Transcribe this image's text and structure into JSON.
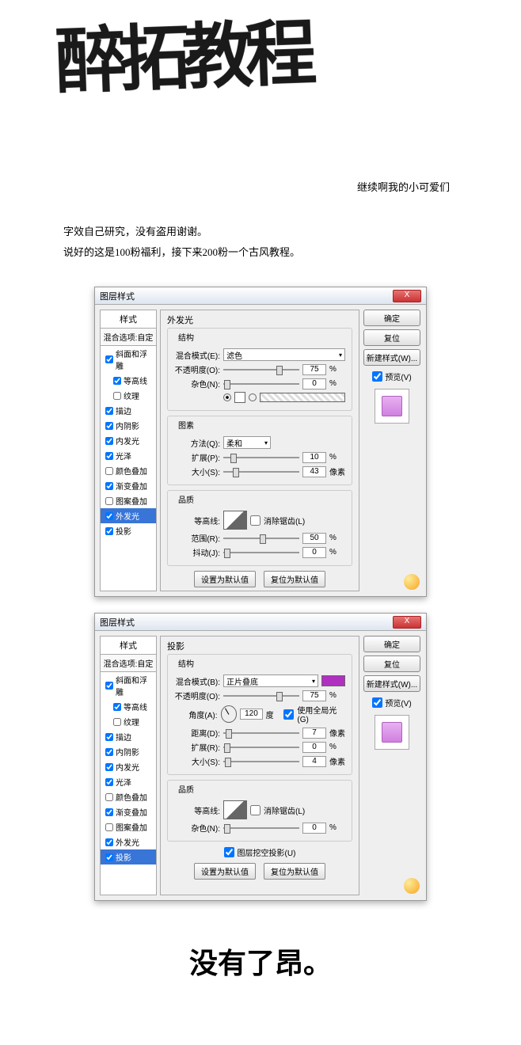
{
  "header": {
    "brush_title": "醉拓教程",
    "sub_caption": "继续啊我的小可爱们"
  },
  "intro": {
    "line1": "字效自己研究，没有盗用谢谢。",
    "line2": "说好的这是100粉福利，接下来200粉一个古风教程。"
  },
  "common": {
    "dialog_title": "图层样式",
    "close": "X",
    "sidebar_header": "样式",
    "sidebar_blend": "混合选项:自定",
    "buttons": {
      "ok": "确定",
      "cancel": "复位",
      "new_style": "新建样式(W)...",
      "preview": "预览(V)",
      "set_default": "设置为默认值",
      "reset_default": "复位为默认值"
    }
  },
  "styles_list": [
    {
      "label": "斜面和浮雕",
      "checked": true
    },
    {
      "label": "等高线",
      "checked": true,
      "indent": true
    },
    {
      "label": "纹理",
      "checked": false,
      "indent": true
    },
    {
      "label": "描边",
      "checked": true
    },
    {
      "label": "内阴影",
      "checked": true
    },
    {
      "label": "内发光",
      "checked": true
    },
    {
      "label": "光泽",
      "checked": true
    },
    {
      "label": "颜色叠加",
      "checked": false
    },
    {
      "label": "渐变叠加",
      "checked": true
    },
    {
      "label": "图案叠加",
      "checked": false
    },
    {
      "label": "外发光",
      "checked": true
    },
    {
      "label": "投影",
      "checked": true
    }
  ],
  "dialog1": {
    "panel_name": "外发光",
    "selected_style": "外发光",
    "groups": {
      "structure": "结构",
      "element": "图素",
      "quality": "品质"
    },
    "structure": {
      "blend_label": "混合模式(E):",
      "blend_value": "滤色",
      "opacity_label": "不透明度(O):",
      "opacity_value": "75",
      "opacity_unit": "%",
      "noise_label": "杂色(N):",
      "noise_value": "0",
      "noise_unit": "%"
    },
    "element": {
      "method_label": "方法(Q):",
      "method_value": "柔和",
      "spread_label": "扩展(P):",
      "spread_value": "10",
      "spread_unit": "%",
      "size_label": "大小(S):",
      "size_value": "43",
      "size_unit": "像素"
    },
    "quality": {
      "contour_label": "等高线:",
      "antialias_label": "消除锯齿(L)",
      "range_label": "范围(R):",
      "range_value": "50",
      "range_unit": "%",
      "jitter_label": "抖动(J):",
      "jitter_value": "0",
      "jitter_unit": "%"
    }
  },
  "dialog2": {
    "panel_name": "投影",
    "selected_style": "投影",
    "groups": {
      "structure": "结构",
      "quality": "品质"
    },
    "structure": {
      "blend_label": "混合模式(B):",
      "blend_value": "正片叠底",
      "color": "#b030c0",
      "opacity_label": "不透明度(O):",
      "opacity_value": "75",
      "opacity_unit": "%",
      "angle_label": "角度(A):",
      "angle_value": "120",
      "angle_unit": "度",
      "global_label": "使用全局光(G)",
      "distance_label": "距离(D):",
      "distance_value": "7",
      "distance_unit": "像素",
      "spread_label": "扩展(R):",
      "spread_value": "0",
      "spread_unit": "%",
      "size_label": "大小(S):",
      "size_value": "4",
      "size_unit": "像素"
    },
    "quality": {
      "contour_label": "等高线:",
      "antialias_label": "消除锯齿(L)",
      "noise_label": "杂色(N):",
      "noise_value": "0",
      "noise_unit": "%"
    },
    "knockout_label": "图层挖空投影(U)"
  },
  "footer": "没有了昂。"
}
